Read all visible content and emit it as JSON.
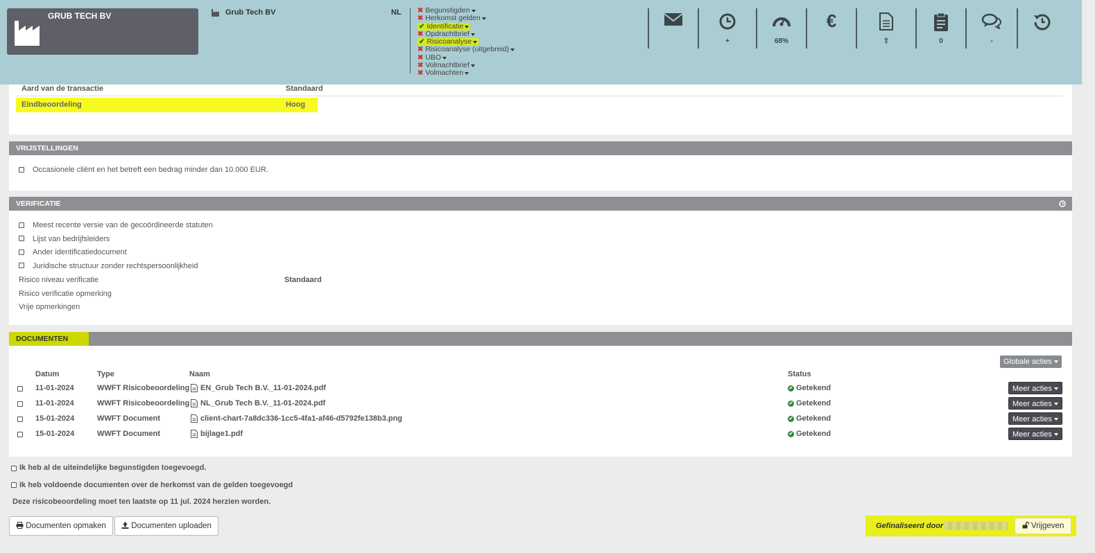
{
  "header": {
    "client_name": "GRUB TECH BV",
    "client_sub": "Grub Tech BV",
    "country": "NL",
    "steps": [
      {
        "label": "Begunstigden",
        "status": "x",
        "highlight": false
      },
      {
        "label": "Herkomst gelden",
        "status": "x",
        "highlight": false
      },
      {
        "label": "Identificatie",
        "status": "ok",
        "highlight": true
      },
      {
        "label": "Opdrachtbrief",
        "status": "x",
        "highlight": false
      },
      {
        "label": "Risicoanalyse",
        "status": "ok",
        "highlight": true
      },
      {
        "label": "Risicoanalyse (uitgebreid)",
        "status": "x",
        "highlight": false
      },
      {
        "label": "UBO",
        "status": "x",
        "highlight": false
      },
      {
        "label": "Volmachtbrief",
        "status": "x",
        "highlight": false
      },
      {
        "label": "Volmachten",
        "status": "x",
        "highlight": false
      }
    ],
    "icons": [
      {
        "name": "envelope-icon",
        "value": ""
      },
      {
        "name": "clock-icon",
        "value": "+"
      },
      {
        "name": "speedometer-icon",
        "value": "68%"
      },
      {
        "name": "euro-icon",
        "value": ""
      },
      {
        "name": "document-icon",
        "value": "⇧"
      },
      {
        "name": "clipboard-icon",
        "value": "0"
      },
      {
        "name": "comments-icon",
        "value": "-"
      },
      {
        "name": "history-icon",
        "value": ""
      }
    ]
  },
  "risk": {
    "transaction_label": "Aard van de transactie",
    "transaction_value": "Standaard",
    "final_label": "Eindbeoordeling",
    "final_value": "Hoog"
  },
  "exemptions": {
    "title": "VRIJSTELLINGEN",
    "items": [
      "Occasionele cliënt en het betreft een bedrag minder dan 10.000 EUR."
    ]
  },
  "verification": {
    "title": "VERIFICATIE",
    "items": [
      "Meest recente versie van de gecoördineerde statuten",
      "Lijst van bedrijfsleiders",
      "Ander identificatiedocument",
      "Juridische structuur zonder rechtspersoonlijkheid"
    ],
    "level_label": "Risico niveau verificatie",
    "level_value": "Standaard",
    "remark_label": "Risico verificatie opmerking",
    "free_label": "Vrije opmerkingen"
  },
  "documents": {
    "title": "DOCUMENTEN",
    "global_actions": "Globale acties",
    "columns": {
      "date": "Datum",
      "type": "Type",
      "name": "Naam",
      "status": "Status"
    },
    "rows": [
      {
        "date": "11-01-2024",
        "type": "WWFT Risicobeoordeling",
        "name": "EN_Grub Tech B.V._11-01-2024.pdf",
        "status": "Getekend",
        "action": "Meer acties"
      },
      {
        "date": "11-01-2024",
        "type": "WWFT Risicobeoordeling",
        "name": "NL_Grub Tech B.V._11-01-2024.pdf",
        "status": "Getekend",
        "action": "Meer acties"
      },
      {
        "date": "15-01-2024",
        "type": "WWFT Document",
        "name": "client-chart-7a8dc336-1cc5-4fa1-af46-d5792fe138b3.png",
        "status": "Getekend",
        "action": "Meer acties"
      },
      {
        "date": "15-01-2024",
        "type": "WWFT Document",
        "name": "bijlage1.pdf",
        "status": "Getekend",
        "action": "Meer acties"
      }
    ]
  },
  "footer": {
    "confirm_beneficiaries": "Ik heb al de uiteindelijke begunstigden toegevoegd.",
    "confirm_funds": "Ik heb voldoende documenten over de herkomst van de gelden toegevoegd",
    "review_notice": "Deze risicobeoordeling moet ten laatste op 11 jul. 2024 herzien worden.",
    "btn_make_docs": "Documenten opmaken",
    "btn_upload_docs": "Documenten uploaden",
    "finalized_by": "Gefinaliseerd door",
    "btn_release": "Vrijgeven"
  }
}
